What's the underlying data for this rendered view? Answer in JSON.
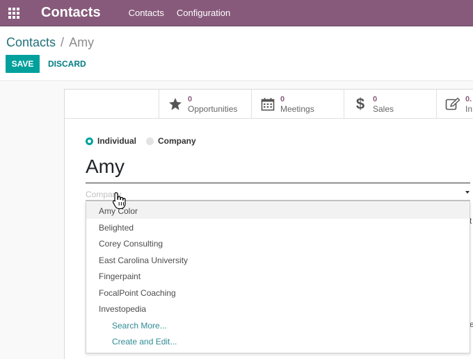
{
  "navbar": {
    "app_title": "Contacts",
    "menu": [
      "Contacts",
      "Configuration"
    ],
    "bg_color": "#875a7b",
    "apps_icon": "grid-icon"
  },
  "breadcrumb": {
    "parent": "Contacts",
    "separator": "/",
    "current": "Amy"
  },
  "actions": {
    "save_label": "SAVE",
    "discard_label": "DISCARD",
    "accent": "#00a09d"
  },
  "smart_buttons": [
    {
      "value": "0",
      "label": "Opportunities",
      "icon": "star-icon"
    },
    {
      "value": "0",
      "label": "Meetings",
      "icon": "calendar-icon"
    },
    {
      "value": "0",
      "label": "Sales",
      "icon": "dollar-icon"
    },
    {
      "value": "0.",
      "label": "In",
      "icon": "edit-icon"
    }
  ],
  "form": {
    "type_options": [
      {
        "label": "Individual",
        "selected": true
      },
      {
        "label": "Company",
        "selected": false
      }
    ],
    "name": "Amy",
    "company_placeholder": "Company"
  },
  "dropdown": {
    "items": [
      "Amy Color",
      "Belighted",
      "Corey Consulting",
      "East Carolina University",
      "Fingerpaint",
      "FocalPoint Coaching",
      "Investopedia"
    ],
    "highlighted_index": 0,
    "links": [
      "Search More...",
      "Create and Edit..."
    ]
  },
  "edge_glyphs": [
    "t",
    "e"
  ]
}
